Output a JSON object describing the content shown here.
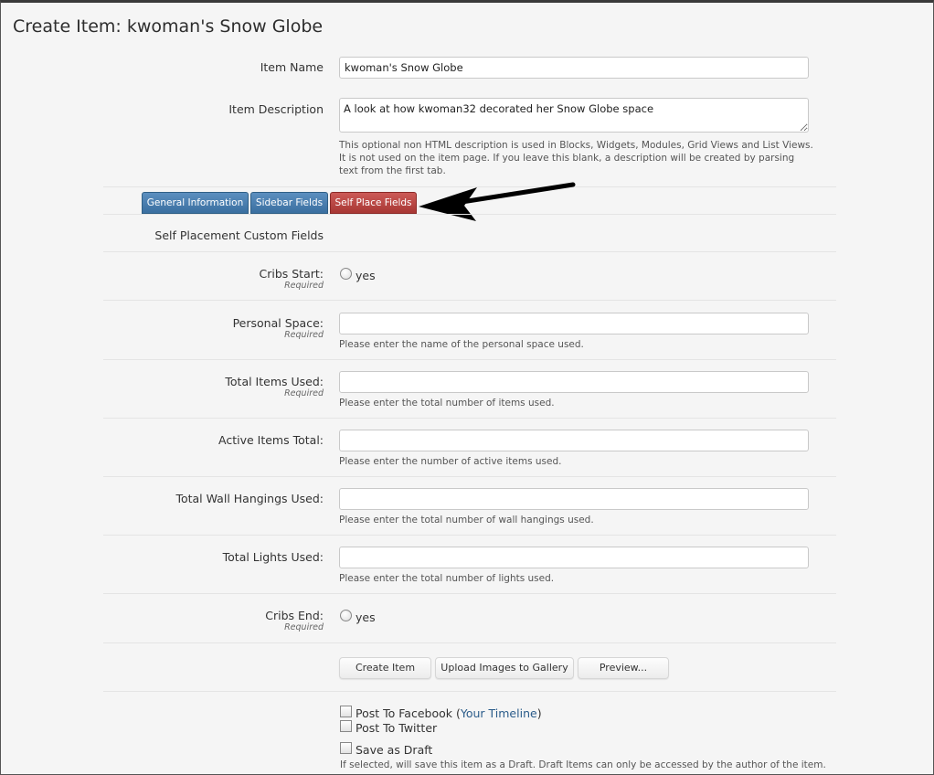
{
  "page": {
    "title": "Create Item: kwoman's Snow Globe"
  },
  "item_name": {
    "label": "Item Name",
    "value": "kwoman's Snow Globe"
  },
  "item_description": {
    "label": "Item Description",
    "value": "A look at how kwoman32 decorated her Snow Globe space",
    "hint": "This optional non HTML description is used in Blocks, Widgets, Modules, Grid Views and List Views. It is not used on the item page. If you leave this blank, a description will be created by parsing text from the first tab."
  },
  "tabs": [
    {
      "label": "General Information",
      "active": false
    },
    {
      "label": "Sidebar Fields",
      "active": false
    },
    {
      "label": "Self Place Fields",
      "active": true
    }
  ],
  "section_heading": "Self Placement Custom Fields",
  "required_text": "Required",
  "fields": {
    "cribs_start": {
      "label": "Cribs Start:",
      "option": "yes"
    },
    "personal_space": {
      "label": "Personal Space:",
      "value": "",
      "hint": "Please enter the name of the personal space used."
    },
    "total_items_used": {
      "label": "Total Items Used:",
      "value": "",
      "hint": "Please enter the total number of items used."
    },
    "active_items_total": {
      "label": "Active Items Total:",
      "value": "",
      "hint": "Please enter the number of active items used."
    },
    "total_wall_hangings": {
      "label": "Total Wall Hangings Used:",
      "value": "",
      "hint": "Please enter the total number of wall hangings used."
    },
    "total_lights_used": {
      "label": "Total Lights Used:",
      "value": "",
      "hint": "Please enter the total number of lights used."
    },
    "cribs_end": {
      "label": "Cribs End:",
      "option": "yes"
    }
  },
  "buttons": {
    "create": "Create Item",
    "upload": "Upload Images to Gallery",
    "preview": "Preview..."
  },
  "options": {
    "facebook_label": "Post To Facebook",
    "facebook_link_open": "(",
    "facebook_link": "Your Timeline",
    "facebook_link_close": ")",
    "twitter_label": "Post To Twitter",
    "draft_label": "Save as Draft",
    "draft_hint": "If selected, will save this item as a Draft. Draft Items can only be accessed by the author of the item."
  },
  "icons": {
    "arrow": "arrow-left-icon"
  },
  "colors": {
    "tab_blue": "#3a6fa0",
    "tab_red": "#a83734",
    "link": "#2b5c8a"
  }
}
